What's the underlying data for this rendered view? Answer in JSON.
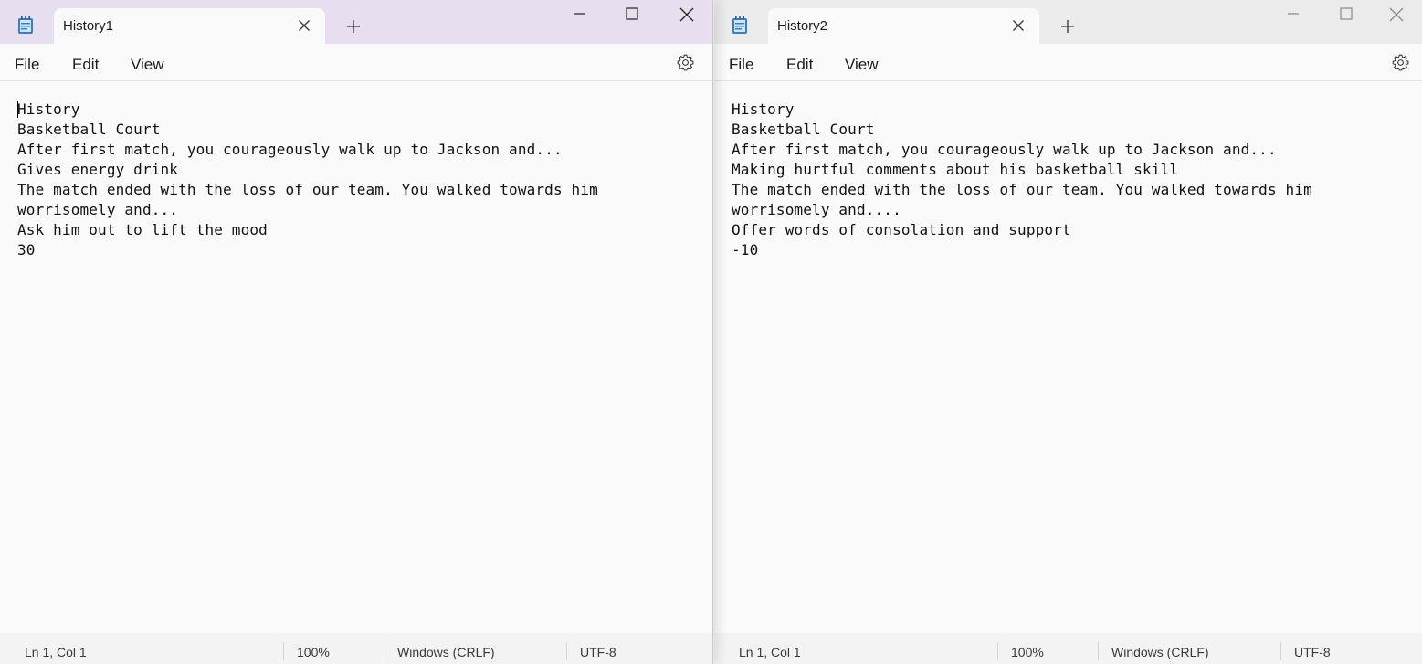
{
  "windows": [
    {
      "tab_title": "History1",
      "menu": {
        "file": "File",
        "edit": "Edit",
        "view": "View"
      },
      "lines": [
        "History",
        "Basketball Court",
        "After first match, you courageously walk up to Jackson and...",
        "Gives energy drink",
        "The match ended with the loss of our team. You walked towards him",
        "worrisomely and...",
        "Ask him out to lift the mood",
        "30"
      ],
      "status": {
        "position": "Ln 1, Col 1",
        "zoom": "100%",
        "line_ending": "Windows (CRLF)",
        "encoding": "UTF-8"
      }
    },
    {
      "tab_title": "History2",
      "menu": {
        "file": "File",
        "edit": "Edit",
        "view": "View"
      },
      "lines": [
        "History",
        "Basketball Court",
        "After first match, you courageously walk up to Jackson and...",
        "Making hurtful comments about his basketball skill",
        "The match ended with the loss of our team. You walked towards him",
        "worrisomely and....",
        "Offer words of consolation and support",
        "-10"
      ],
      "status": {
        "position": "Ln 1, Col 1",
        "zoom": "100%",
        "line_ending": "Windows (CRLF)",
        "encoding": "UTF-8"
      }
    }
  ],
  "icons": {
    "app": "notepad-icon",
    "tab_close": "close-icon",
    "new_tab": "plus-icon",
    "minimize": "minimize-icon",
    "maximize": "maximize-icon",
    "close": "close-icon",
    "settings": "gear-icon"
  },
  "colors": {
    "active_titlebar": "#e7dff0",
    "inactive_titlebar": "#ebebeb",
    "editor_bg": "#fafafa",
    "statusbar_bg": "#f3f3f3"
  }
}
